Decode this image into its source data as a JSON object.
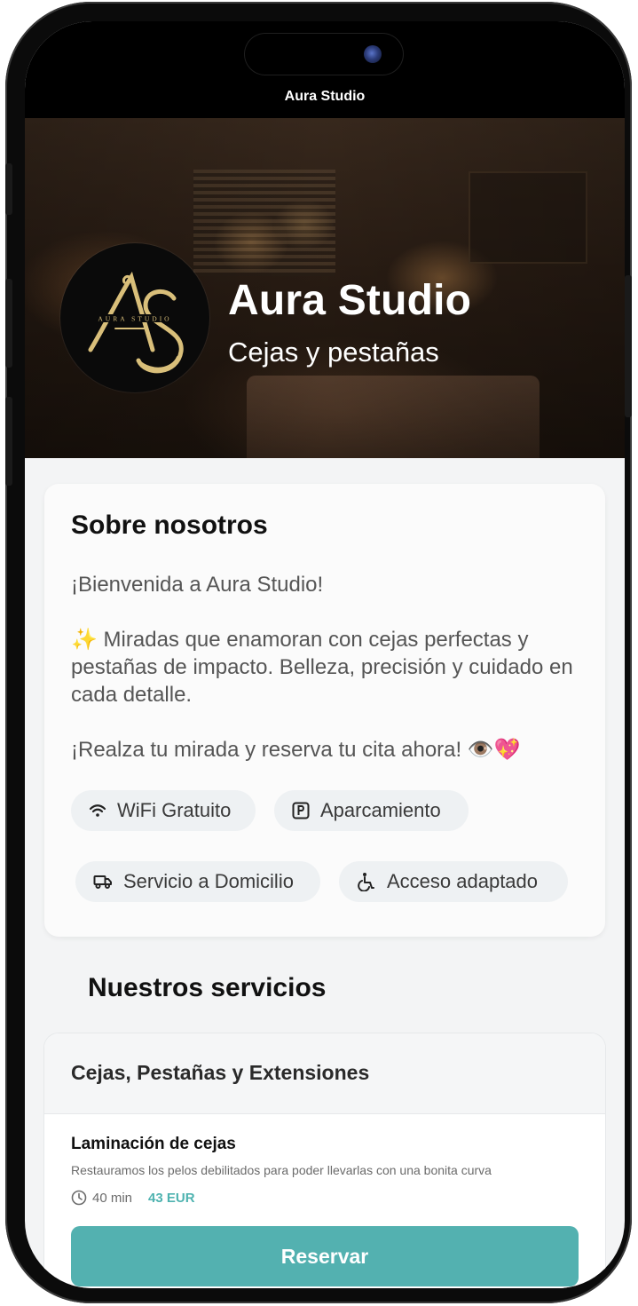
{
  "app": {
    "title": "Aura Studio"
  },
  "hero": {
    "name": "Aura Studio",
    "subtitle": "Cejas y pestañas",
    "logo_monogram": "AS",
    "logo_text": "AURA STUDIO"
  },
  "about": {
    "title": "Sobre nosotros",
    "text": "¡Bienvenida a Aura Studio!\n\n✨ Miradas que enamoran con cejas perfectas y pestañas de impacto. Belleza, precisión y cuidado en cada detalle.\n\n¡Realza tu mirada y reserva tu cita ahora! 👁️💖",
    "amenities": [
      {
        "label": "WiFi Gratuito",
        "icon": "wifi-icon"
      },
      {
        "label": "Aparcamiento",
        "icon": "parking-icon"
      },
      {
        "label": "Servicio a Domicilio",
        "icon": "truck-icon"
      },
      {
        "label": "Acceso adaptado",
        "icon": "wheelchair-icon"
      }
    ]
  },
  "services": {
    "section_title": "Nuestros servicios",
    "category": "Cejas, Pestañas y Extensiones",
    "items": [
      {
        "name": "Laminación de cejas",
        "description": "Restauramos los pelos debilitados para poder llevarlas con una bonita curva",
        "duration": "40 min",
        "price": "43 EUR",
        "button_label": "Reservar"
      }
    ]
  },
  "colors": {
    "accent": "#53b1b0",
    "price": "#4fb3b0",
    "logo_gold": "#d9bf7a"
  }
}
